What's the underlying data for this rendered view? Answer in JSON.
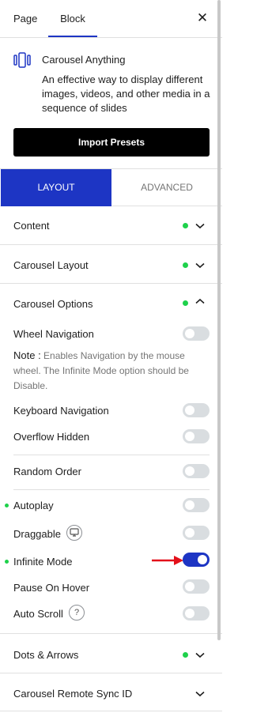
{
  "tabs": {
    "page": "Page",
    "block": "Block"
  },
  "block": {
    "title": "Carousel Anything",
    "description": "An effective way to display different images, videos, and other media in a sequence of slides",
    "import_label": "Import Presets"
  },
  "segment": {
    "layout": "LAYOUT",
    "advanced": "ADVANCED"
  },
  "panels": {
    "content": "Content",
    "carousel_layout": "Carousel Layout",
    "carousel_options": "Carousel Options",
    "dots_arrows": "Dots & Arrows",
    "remote_sync": "Carousel Remote Sync ID"
  },
  "options": {
    "wheel_navigation": "Wheel Navigation",
    "note_label": "Note :",
    "note_text": "Enables Navigation by the mouse wheel. The Infinite Mode option should be Disable.",
    "keyboard_navigation": "Keyboard Navigation",
    "overflow_hidden": "Overflow Hidden",
    "random_order": "Random Order",
    "autoplay": "Autoplay",
    "draggable": "Draggable",
    "infinite_mode": "Infinite Mode",
    "pause_on_hover": "Pause On Hover",
    "auto_scroll": "Auto Scroll",
    "help_glyph": "?"
  },
  "toggles": {
    "wheel_navigation": false,
    "keyboard_navigation": false,
    "overflow_hidden": false,
    "random_order": false,
    "autoplay": false,
    "draggable": false,
    "infinite_mode": true,
    "pause_on_hover": false,
    "auto_scroll": false
  },
  "icons": {
    "close": "close-icon",
    "block": "carousel-icon",
    "chevron_down": "chevron-down-icon",
    "chevron_up": "chevron-up-icon",
    "monitor": "monitor-icon",
    "help": "help-icon",
    "annotation": "red-arrow-icon"
  },
  "colors": {
    "accent": "#1d35c4",
    "status_dot": "#1ed14b",
    "annotation": "#e3101a"
  }
}
